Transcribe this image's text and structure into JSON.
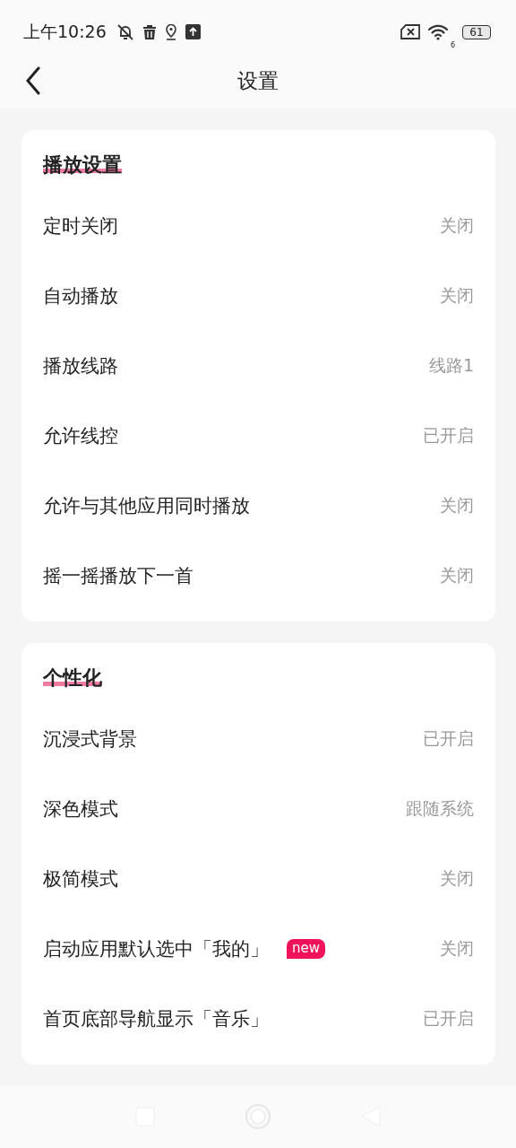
{
  "status_bar": {
    "time": "上午10:26",
    "wifi_label": "6",
    "battery": "61"
  },
  "header": {
    "title": "设置"
  },
  "sections": [
    {
      "title": "播放设置",
      "rows": [
        {
          "label": "定时关闭",
          "value": "关闭"
        },
        {
          "label": "自动播放",
          "value": "关闭"
        },
        {
          "label": "播放线路",
          "value": "线路1"
        },
        {
          "label": "允许线控",
          "value": "已开启"
        },
        {
          "label": "允许与其他应用同时播放",
          "value": "关闭"
        },
        {
          "label": "摇一摇播放下一首",
          "value": "关闭"
        }
      ]
    },
    {
      "title": "个性化",
      "rows": [
        {
          "label": "沉浸式背景",
          "value": "已开启"
        },
        {
          "label": "深色模式",
          "value": "跟随系统"
        },
        {
          "label": "极简模式",
          "value": "关闭"
        },
        {
          "label": "启动应用默认选中「我的」",
          "badge": "new",
          "value": "关闭"
        },
        {
          "label": "首页底部导航显示「音乐」",
          "value": "已开启"
        }
      ]
    }
  ]
}
